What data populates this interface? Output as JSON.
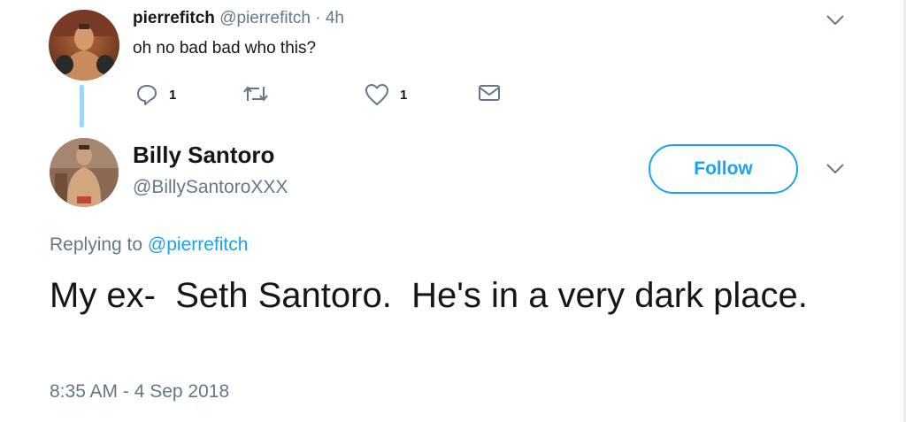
{
  "parent_tweet": {
    "author_name": "pierrefitch",
    "author_handle": "@pierrefitch",
    "separator": "·",
    "time_ago": "4h",
    "text": "oh no bad bad who this?",
    "reply_count": "1",
    "like_count": "1",
    "icons": [
      "reply-icon",
      "retweet-icon",
      "heart-icon",
      "envelope-icon",
      "chevron-down-icon"
    ]
  },
  "main_tweet": {
    "author_name": "Billy Santoro",
    "author_handle": "@BillySantoroXXX",
    "follow_label": "Follow",
    "replying_prefix": "Replying to",
    "replying_to": "@pierrefitch",
    "text": "My ex-  Seth Santoro.  He's in a very dark place.",
    "timestamp": "8:35 AM - 4 Sep 2018"
  },
  "colors": {
    "accent": "#1da1f2",
    "text_primary": "#14171a",
    "text_secondary": "#657786",
    "thread_line": "#a3d4f5"
  }
}
